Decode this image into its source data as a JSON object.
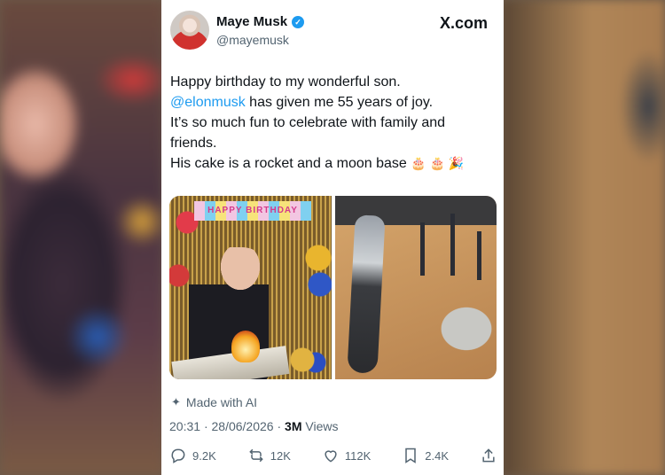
{
  "tweet": {
    "author_name": "Maye Musk",
    "handle": "@mayemusk",
    "brand": "X.com",
    "text_lines": [
      "Happy birthday to my wonderful son.",
      "has given me 55 years of joy.",
      "It’s so much fun to celebrate with family and",
      "friends.",
      "His cake is a rocket and a moon base"
    ],
    "mention": "@elonmusk",
    "emojis": "🎂 🎂 🎉",
    "banner_text": "HAPPY BIRTHDAY",
    "made_with": "Made with AI",
    "time": "20:31",
    "date": "28/06/2026",
    "views_count": "3M",
    "views_label": "Views",
    "separator": "·",
    "replies": "9.2K",
    "reposts": "12K",
    "likes": "112K",
    "bookmarks": "2.4K"
  },
  "icons": {
    "verified": "verified-badge-icon",
    "reply": "reply-icon",
    "repost": "repost-icon",
    "like": "like-icon",
    "bookmark": "bookmark-icon",
    "share": "share-icon",
    "ai": "sparkle-icon"
  },
  "colors": {
    "accent": "#1d9bf0",
    "text": "#0f1419",
    "muted": "#536471"
  }
}
